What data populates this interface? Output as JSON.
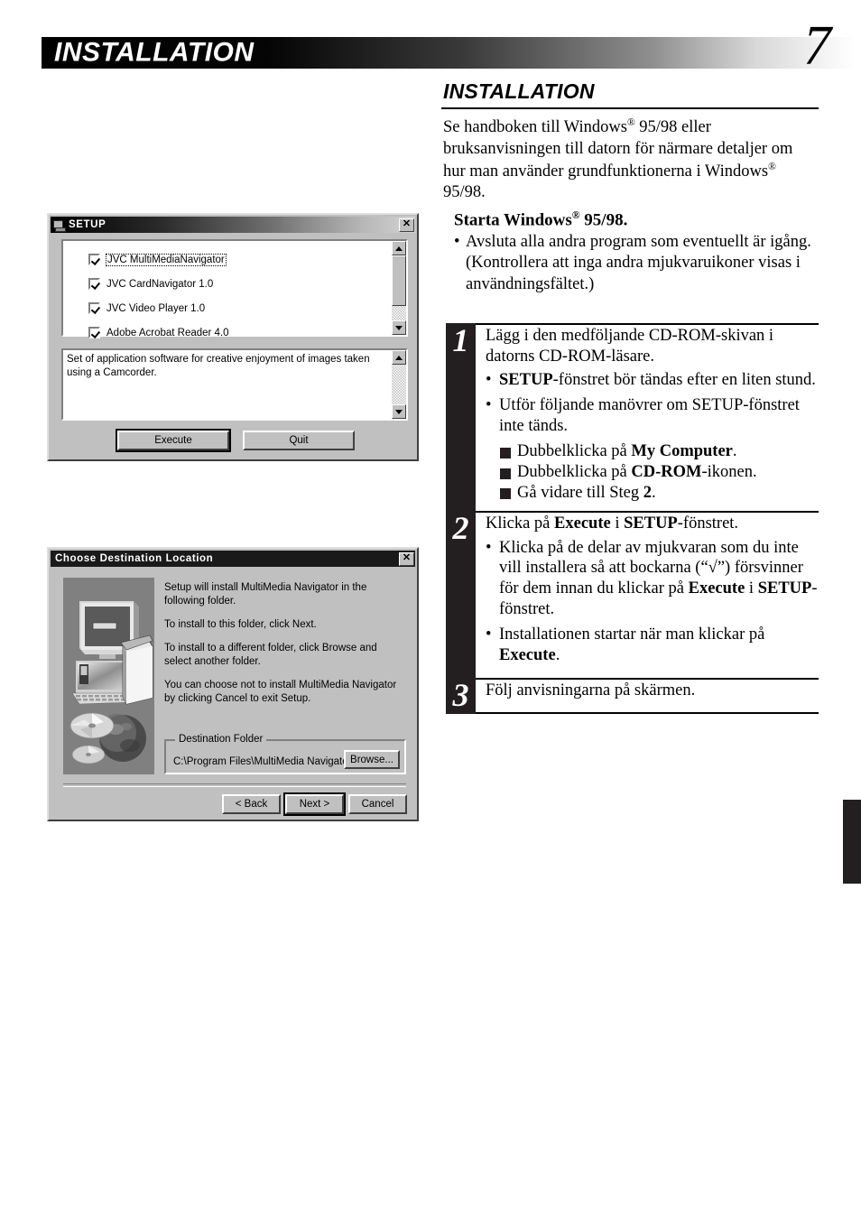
{
  "header": {
    "title": "INSTALLATION",
    "page_number": "7"
  },
  "right_column": {
    "section_title": "INSTALLATION",
    "intro_line1": "Se handboken till Windows",
    "intro_sup1": "®",
    "intro_line1b": " 95/98 eller",
    "intro_rest": "bruksanvisningen till datorn för närmare detaljer om hur man använder grundfunktionerna i Windows",
    "intro_sup2": "®",
    "intro_end": " 95/98.",
    "sub_head": "Starta Windows",
    "sub_head_sup": "®",
    "sub_head_end": " 95/98.",
    "bullet_dot": "•",
    "sub_bullet": "Avsluta alla andra program som eventuellt är igång. (Kontrollera att inga andra mjukvaruikoner visas i användningsfältet.)"
  },
  "steps": [
    {
      "number": "1",
      "lead": "Lägg i den medföljande CD-ROM-skivan i datorns CD-ROM-läsare.",
      "bullets": [
        {
          "parts": [
            {
              "t": "SETUP",
              "b": true
            },
            {
              "t": "-fönstret bör tändas efter en liten stund.",
              "b": false
            }
          ]
        },
        {
          "parts": [
            {
              "t": "Utför följande manövrer om SETUP-fönstret inte tänds.",
              "b": false
            }
          ]
        }
      ],
      "squares": [
        {
          "parts": [
            {
              "t": "Dubbelklicka på ",
              "b": false
            },
            {
              "t": "My Computer",
              "b": true
            },
            {
              "t": ".",
              "b": false
            }
          ]
        },
        {
          "parts": [
            {
              "t": "Dubbelklicka på ",
              "b": false
            },
            {
              "t": "CD-ROM",
              "b": true
            },
            {
              "t": "-ikonen.",
              "b": false
            }
          ]
        },
        {
          "parts": [
            {
              "t": "Gå vidare till Steg ",
              "b": false
            },
            {
              "t": "2",
              "b": true
            },
            {
              "t": ".",
              "b": false
            }
          ]
        }
      ]
    },
    {
      "number": "2",
      "lead_parts": [
        {
          "t": "Klicka på ",
          "b": false
        },
        {
          "t": "Execute",
          "b": true
        },
        {
          "t": " i ",
          "b": false
        },
        {
          "t": "SETUP",
          "b": true
        },
        {
          "t": "-fönstret.",
          "b": false
        }
      ],
      "bullets": [
        {
          "parts": [
            {
              "t": "Klicka på de delar av mjukvaran som du inte vill installera så att bockarna (“√”) försvinner för dem innan du klickar på ",
              "b": false
            },
            {
              "t": "Execute",
              "b": true
            },
            {
              "t": " i ",
              "b": false
            },
            {
              "t": "SETUP",
              "b": true
            },
            {
              "t": "-fönstret.",
              "b": false
            }
          ]
        },
        {
          "parts": [
            {
              "t": "Installationen startar när man klickar på ",
              "b": false
            },
            {
              "t": "Execute",
              "b": true
            },
            {
              "t": ".",
              "b": false
            }
          ]
        }
      ],
      "squares": []
    },
    {
      "number": "3",
      "lead": "Följ anvisningarna på skärmen.",
      "bullets": [],
      "squares": []
    }
  ],
  "setup_dialog": {
    "title": "SETUP",
    "close_label": "✕",
    "items": [
      {
        "label": "JVC MultiMediaNavigator",
        "checked": true,
        "selected": true
      },
      {
        "label": "JVC CardNavigator 1.0",
        "checked": true,
        "selected": false
      },
      {
        "label": "JVC Video Player 1.0",
        "checked": true,
        "selected": false
      },
      {
        "label": "Adobe Acrobat Reader 4.0",
        "checked": true,
        "selected": false
      }
    ],
    "description": "Set of application software for creative enjoyment of images taken using a Camcorder.",
    "execute_label": "Execute",
    "quit_label": "Quit"
  },
  "destination_dialog": {
    "title": "Choose Destination Location",
    "close_label": "✕",
    "paragraphs": [
      "Setup will install MultiMedia Navigator in the following folder.",
      "To install to this folder, click Next.",
      "To install to a different folder, click Browse and select another folder.",
      "You can choose not to install MultiMedia Navigator by clicking Cancel to exit Setup."
    ],
    "group_label": "Destination Folder",
    "folder_path": "C:\\Program Files\\MultiMedia Navigator",
    "browse_label": "Browse...",
    "back_label": "< Back",
    "next_label": "Next >",
    "cancel_label": "Cancel"
  }
}
